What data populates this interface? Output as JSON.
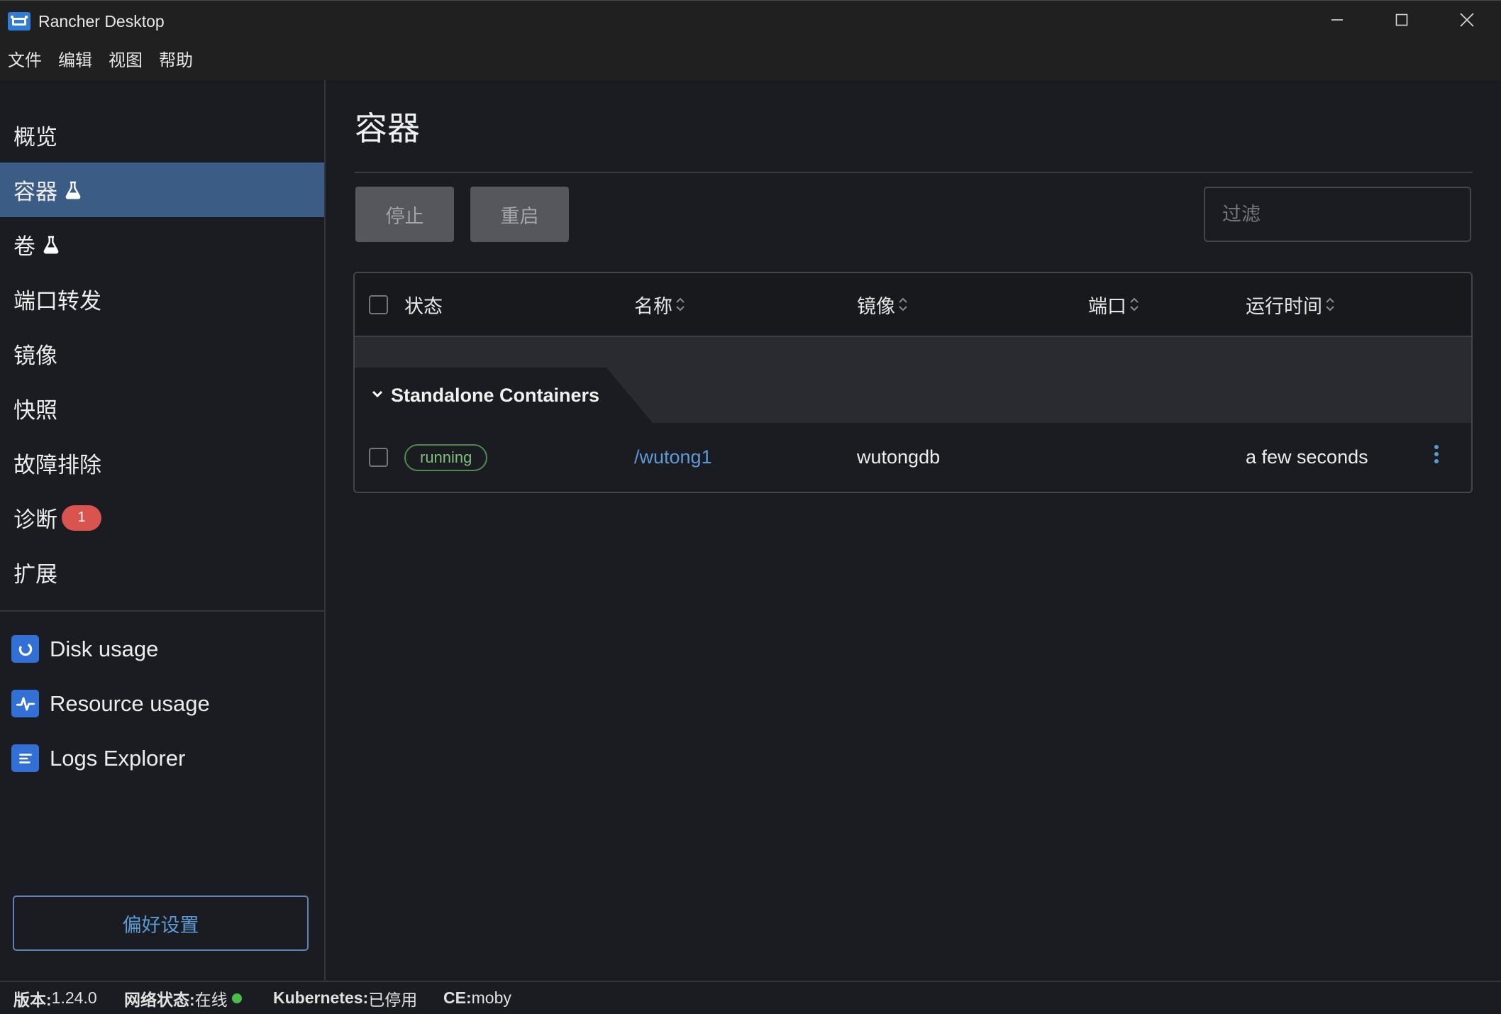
{
  "window": {
    "title": "Rancher Desktop",
    "app_icon": "rancher-logo-icon",
    "controls": [
      "minimize-icon",
      "maximize-icon",
      "close-icon"
    ]
  },
  "menu": {
    "items": [
      "文件",
      "编辑",
      "视图",
      "帮助"
    ]
  },
  "sidebar": {
    "items": [
      {
        "label": "概览"
      },
      {
        "label": "容器",
        "active": true,
        "experimental": true
      },
      {
        "label": "卷",
        "experimental": true
      },
      {
        "label": "端口转发"
      },
      {
        "label": "镜像"
      },
      {
        "label": "快照"
      },
      {
        "label": "故障排除"
      },
      {
        "label": "诊断",
        "badge": "1"
      },
      {
        "label": "扩展"
      }
    ],
    "experimental_icon": "flask-icon",
    "extensions": [
      {
        "label": "Disk usage",
        "icon": "disk-usage-icon"
      },
      {
        "label": "Resource usage",
        "icon": "pulse-icon"
      },
      {
        "label": "Logs Explorer",
        "icon": "logs-icon"
      }
    ],
    "preferences_label": "偏好设置"
  },
  "page": {
    "title": "容器"
  },
  "toolbar": {
    "stop_label": "停止",
    "restart_label": "重启",
    "buttons_disabled": true,
    "filter_placeholder": "过滤"
  },
  "table": {
    "columns": [
      {
        "label": "状态",
        "sortable": false
      },
      {
        "label": "名称",
        "sortable": true
      },
      {
        "label": "镜像",
        "sortable": true
      },
      {
        "label": "端口",
        "sortable": true
      },
      {
        "label": "运行时间",
        "sortable": true
      }
    ],
    "groups": [
      {
        "label": "Standalone Containers",
        "expanded": true,
        "rows": [
          {
            "checked": false,
            "state": "running",
            "name": "/wutong1",
            "image": "wutongdb",
            "ports": "",
            "uptime": "a few seconds"
          }
        ]
      }
    ]
  },
  "status_bar": {
    "version_label": "版本:",
    "version": "1.24.0",
    "network_label": "网络状态:",
    "network": "在线",
    "kubernetes_label": "Kubernetes:",
    "kubernetes": "已停用",
    "ce_label": "CE:",
    "ce": "moby"
  },
  "colors": {
    "background": "#1b1c21",
    "titlebar": "#202020",
    "accent": "#5b9bd5",
    "active_nav": "#3b5c85",
    "running": "#7cbf7c",
    "badge": "#d9534f",
    "online": "#4cbb4c",
    "extension_icon": "#3370d6"
  }
}
